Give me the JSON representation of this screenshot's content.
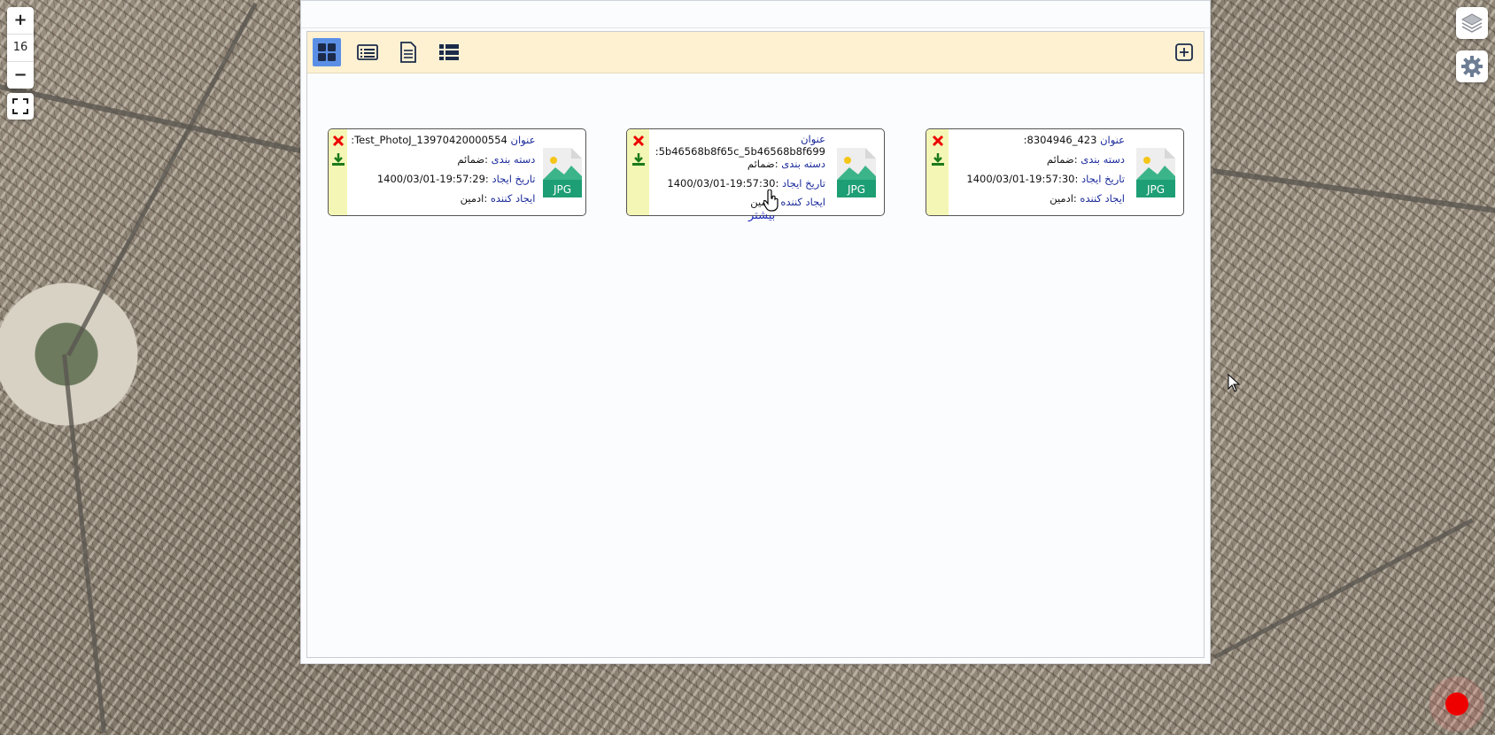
{
  "map": {
    "zoom_in_label": "+",
    "zoom_level": "16",
    "zoom_out_label": "−",
    "fullscreen_icon": "fullscreen-icon",
    "layers_icon": "layers-icon",
    "settings_icon": "gear-icon",
    "record_color": "#e00000"
  },
  "toolbar": {
    "views": [
      {
        "icon": "grid-view-icon",
        "active": true
      },
      {
        "icon": "list-card-view-icon",
        "active": false
      },
      {
        "icon": "document-view-icon",
        "active": false
      },
      {
        "icon": "detail-list-view-icon",
        "active": false
      }
    ],
    "add_icon": "add-square-icon",
    "accent_color": "#5b8fe6",
    "background_color": "#fdf1d2"
  },
  "cards": [
    {
      "title_label": "عنوان",
      "title_value": "423_8304946:",
      "category_label": "دسته بندی",
      "category_value": ":ضمائم",
      "date_label": "تاریخ ایجاد",
      "date_value": ":19:57:30-1400/03/01",
      "creator_label": "ایجاد کننده",
      "creator_value": ":ادمین",
      "file_type": "JPG"
    },
    {
      "title_label": "عنوان",
      "title_value": "5b46568b8f65c_5b46568b8f699:",
      "category_label": "دسته بندی",
      "category_value": ":ضمائم",
      "date_label": "تاریخ ایجاد",
      "date_value": ":19:57:30-1400/03/01",
      "creator_label": "ایجاد کننده",
      "creator_value": ":ادمین",
      "file_type": "JPG"
    },
    {
      "title_label": "عنوان",
      "title_value": "Test_PhotoJ_13970420000554:",
      "category_label": "دسته بندی",
      "category_value": ":ضمائم",
      "date_label": "تاریخ ایجاد",
      "date_value": ":19:57:29-1400/03/01",
      "creator_label": "ایجاد کننده",
      "creator_value": ":ادمین",
      "file_type": "JPG"
    }
  ],
  "more_label": "بیشتر"
}
